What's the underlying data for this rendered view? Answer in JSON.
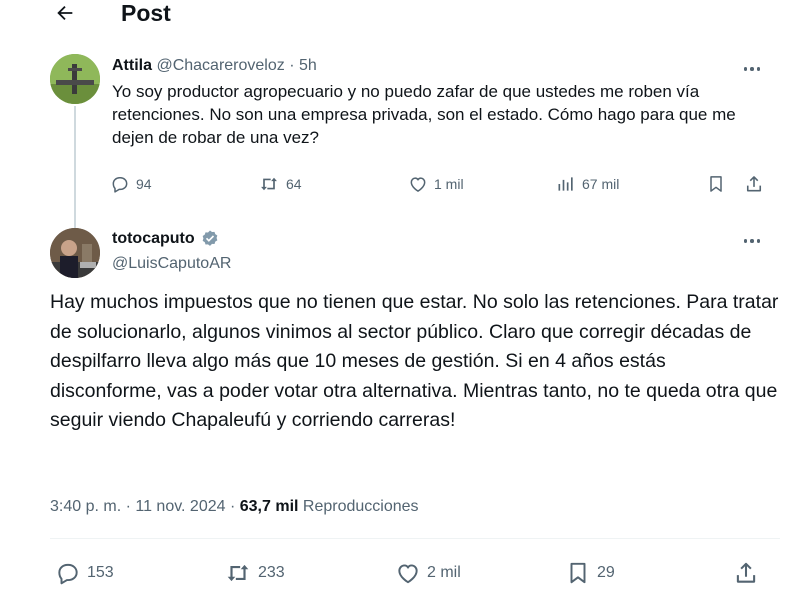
{
  "header": {
    "title": "Post"
  },
  "reply_tweet": {
    "name": "Attila",
    "handle": "@Chacareroveloz",
    "time": "· 5h",
    "text": "Yo soy productor agropecuario y no puedo zafar de que ustedes me roben vía retenciones. No son una empresa privada, son el estado. Cómo hago para que me dejen de robar de una vez?",
    "replies": "94",
    "reposts": "64",
    "likes": "1 mil",
    "views": "67 mil"
  },
  "main_tweet": {
    "name": "totocaputo",
    "handle": "@LuisCaputoAR",
    "text": "Hay muchos impuestos que no tienen que estar. No solo las retenciones. Para tratar de solucionarlo, algunos vinimos al sector público.  Claro que corregir décadas de despilfarro lleva algo más que 10 meses de gestión. Si en 4 años estás disconforme, vas a poder votar otra alternativa. Mientras tanto, no te queda otra que seguir viendo Chapaleufú y corriendo carreras!",
    "timestamp": "3:40 p. m. · 11 nov. 2024 ·",
    "views_count": "63,7 mil",
    "views_label": "Reproducciones",
    "replies": "153",
    "reposts": "233",
    "likes": "2 mil",
    "bookmarks": "29"
  },
  "colors": {
    "text": "#0f1419",
    "secondary": "#536471",
    "verified": "#829aab",
    "divider": "#eff3f4"
  }
}
